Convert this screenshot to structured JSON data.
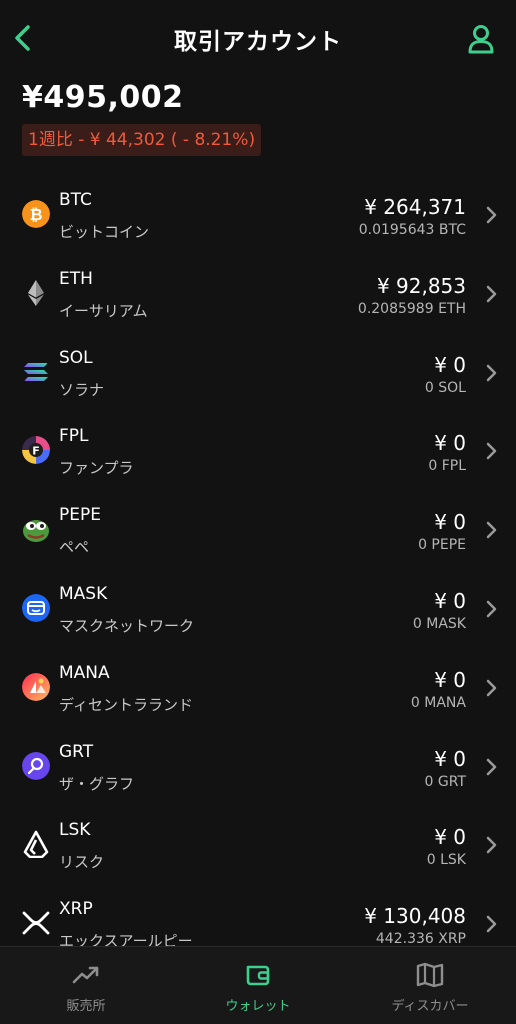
{
  "header": {
    "title": "取引アカウント"
  },
  "balance": {
    "total": "¥495,002",
    "change": "1週比 - ¥ 44,302 ( - 8.21%)"
  },
  "colors": {
    "accent": "#3ecf8e",
    "negative": "#ef5a3c",
    "background": "#121212"
  },
  "coins": [
    {
      "symbol": "BTC",
      "name": "ビットコイン",
      "value": "¥ 264,371",
      "amount": "0.0195643 BTC",
      "icon": "bitcoin-icon"
    },
    {
      "symbol": "ETH",
      "name": "イーサリアム",
      "value": "¥ 92,853",
      "amount": "0.2085989 ETH",
      "icon": "ethereum-icon"
    },
    {
      "symbol": "SOL",
      "name": "ソラナ",
      "value": "¥ 0",
      "amount": "0 SOL",
      "icon": "solana-icon"
    },
    {
      "symbol": "FPL",
      "name": "ファンプラ",
      "value": "¥ 0",
      "amount": "0 FPL",
      "icon": "fpl-icon"
    },
    {
      "symbol": "PEPE",
      "name": "ペペ",
      "value": "¥ 0",
      "amount": "0 PEPE",
      "icon": "pepe-icon"
    },
    {
      "symbol": "MASK",
      "name": "マスクネットワーク",
      "value": "¥ 0",
      "amount": "0 MASK",
      "icon": "mask-icon"
    },
    {
      "symbol": "MANA",
      "name": "ディセントラランド",
      "value": "¥ 0",
      "amount": "0 MANA",
      "icon": "mana-icon"
    },
    {
      "symbol": "GRT",
      "name": "ザ・グラフ",
      "value": "¥ 0",
      "amount": "0 GRT",
      "icon": "graph-icon"
    },
    {
      "symbol": "LSK",
      "name": "リスク",
      "value": "¥ 0",
      "amount": "0 LSK",
      "icon": "lisk-icon"
    },
    {
      "symbol": "XRP",
      "name": "エックスアールピー",
      "value": "¥ 130,408",
      "amount": "442.336 XRP",
      "icon": "xrp-icon"
    }
  ],
  "tabs": [
    {
      "label": "販売所",
      "icon": "chart-trend-icon",
      "active": false
    },
    {
      "label": "ウォレット",
      "icon": "wallet-icon",
      "active": true
    },
    {
      "label": "ディスカバー",
      "icon": "map-icon",
      "active": false
    }
  ]
}
